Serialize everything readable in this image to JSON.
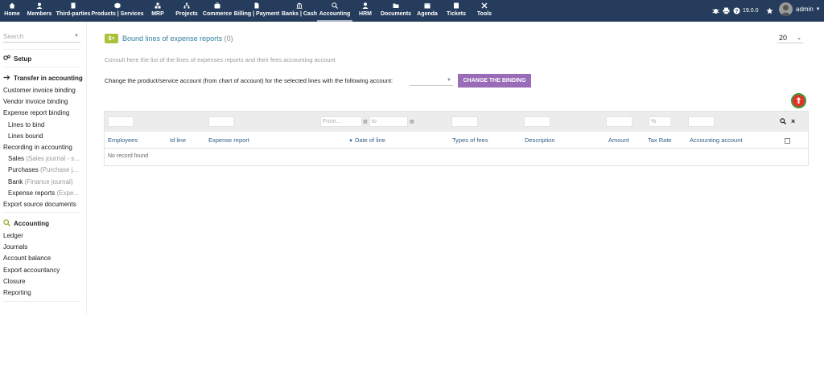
{
  "topbar": {
    "menu": [
      {
        "label": "Home",
        "icon": "home-icon"
      },
      {
        "label": "Members",
        "icon": "members-icon"
      },
      {
        "label": "Third-parties",
        "icon": "building-icon"
      },
      {
        "label": "Products | Services",
        "icon": "cube-icon"
      },
      {
        "label": "MRP",
        "icon": "cubes-icon"
      },
      {
        "label": "Projects",
        "icon": "sitemap-icon"
      },
      {
        "label": "Commerce",
        "icon": "suitcase-icon"
      },
      {
        "label": "Billing | Payment",
        "icon": "file-invoice-icon"
      },
      {
        "label": "Banks | Cash",
        "icon": "bank-icon"
      },
      {
        "label": "Accounting",
        "icon": "search-dollar-icon"
      },
      {
        "label": "HRM",
        "icon": "user-tie-icon"
      },
      {
        "label": "Documents",
        "icon": "folder-icon"
      },
      {
        "label": "Agenda",
        "icon": "calendar-icon"
      },
      {
        "label": "Tickets",
        "icon": "ticket-icon"
      },
      {
        "label": "Tools",
        "icon": "tools-icon"
      }
    ],
    "version": "19.0.0",
    "user": "admin",
    "colors": {
      "bar": "#263c5c"
    }
  },
  "sidebar": {
    "search_placeholder": "Search",
    "setup": "Setup",
    "transfer_heading": "Transfer in accounting",
    "transfer_items": {
      "customer_invoice_binding": "Customer invoice binding",
      "vendor_invoice_binding": "Vendor invoice binding",
      "expense_report_binding": "Expense report binding",
      "lines_to_bind": "Lines to bind",
      "lines_bound": "Lines bound",
      "recording": "Recording in accounting",
      "sales": "Sales",
      "sales_note": "(Sales journal - s...",
      "purchases": "Purchases",
      "purchases_note": "(Purchase j...",
      "bank": "Bank",
      "bank_note": "(Finance journal)",
      "expense_reports": "Expense reports",
      "expense_reports_note": "(Expe...",
      "export_source": "Export source documents"
    },
    "accounting_heading": "Accounting",
    "accounting_items": {
      "ledger": "Ledger",
      "journals": "Journals",
      "account_balance": "Account balance",
      "export_accountancy": "Export accountancy",
      "closure": "Closure",
      "reporting": "Reporting"
    }
  },
  "main": {
    "title": "Bound lines of expense reports",
    "count": "(0)",
    "limit": "20",
    "intro": "Consult here the list of the lines of expenses reports and their fees accounting account",
    "change_label": "Change the product/service account (from chart of account) for the selected lines with the following account:",
    "change_button": "CHANGE THE BINDING",
    "button_color": "#9a6bb6",
    "filters": {
      "from_placeholder": "From...",
      "to_placeholder": "to",
      "rate_placeholder": "%"
    },
    "columns": {
      "employees": "Employees",
      "id_line": "Id line",
      "expense_report": "Expense report",
      "date_of_line": "Date of line",
      "types_of_fees": "Types of fees",
      "description": "Description",
      "amount": "Amount",
      "tax_rate": "Tax Rate",
      "accounting_account": "Accounting account"
    },
    "empty_message": "No record found"
  }
}
